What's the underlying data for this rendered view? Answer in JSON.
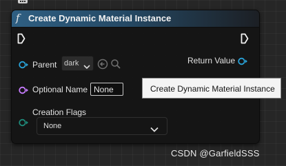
{
  "node": {
    "icon": "function-icon",
    "function_symbol": "f",
    "title": "Create Dynamic Material Instance"
  },
  "pins": {
    "parent": {
      "label": "Parent",
      "value": "dark",
      "color": "#29a3d9"
    },
    "optional_name": {
      "label": "Optional Name",
      "value": "None",
      "color": "#c77cff"
    },
    "creation_flags": {
      "label": "Creation Flags",
      "value": "None",
      "color": "#1f8a7a"
    },
    "return_value": {
      "label": "Return Value",
      "color": "#29a3d9"
    }
  },
  "tooltip": {
    "text": "Create Dynamic Material Instance"
  },
  "watermark": {
    "text": "CSDN @GarfieldSSS"
  },
  "icons": [
    "more-dots-icon",
    "exec-in-pin-icon",
    "exec-out-pin-icon",
    "chevron-down-icon",
    "use-selected-asset-icon",
    "browse-magnifier-icon"
  ]
}
